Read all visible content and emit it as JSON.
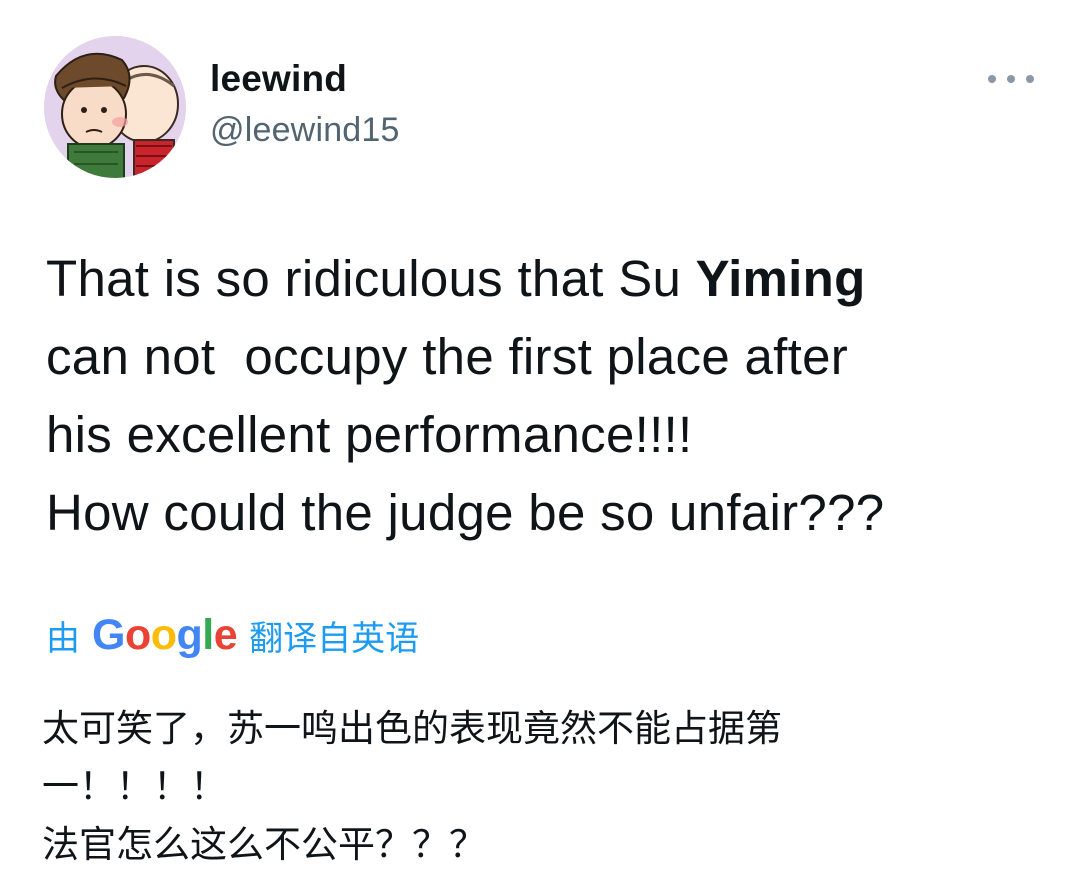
{
  "user": {
    "display_name": "leewind",
    "handle": "@leewind15"
  },
  "tweet": {
    "lines": [
      {
        "pre": "That is so ridiculous that Su ",
        "bold": "Yiming"
      },
      {
        "pre": "can not  occupy the first place after",
        "bold": ""
      },
      {
        "pre": "his excellent performance!!!!",
        "bold": ""
      },
      {
        "pre": "How could the judge be so unfair???",
        "bold": ""
      }
    ]
  },
  "translate": {
    "prefix": "由",
    "brand_letters": [
      "G",
      "o",
      "o",
      "g",
      "l",
      "e"
    ],
    "suffix": "翻译自英语"
  },
  "translation": {
    "lines": [
      "太可笑了，苏一鸣出色的表现竟然不能占据第",
      "一！！！！",
      "法官怎么这么不公平？？？"
    ]
  },
  "colors": {
    "link": "#1d9bf0",
    "secondary_text": "#536471",
    "google_blue": "#4285f4",
    "google_red": "#ea4335",
    "google_yellow": "#fbbc05",
    "google_green": "#34a853"
  },
  "icons": {
    "more": "more-horizontal-icon",
    "avatar": "avatar-image"
  }
}
